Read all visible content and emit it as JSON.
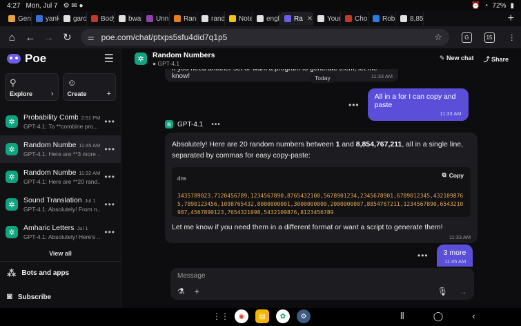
{
  "status_bar": {
    "time": "4:27",
    "date": "Mon, Jul 7",
    "battery": "72%"
  },
  "tabs": [
    {
      "label": "Gene",
      "color": "#e8a33c"
    },
    {
      "label": "yank",
      "color": "#3b6fd8"
    },
    {
      "label": "garo",
      "color": "#e0e0e0"
    },
    {
      "label": "Body",
      "color": "#c0392b"
    },
    {
      "label": "bwa",
      "color": "#e0e0e0"
    },
    {
      "label": "Unn",
      "color": "#8e44ad"
    },
    {
      "label": "Rand",
      "color": "#e67e22"
    },
    {
      "label": "rand",
      "color": "#e0e0e0"
    },
    {
      "label": "Note",
      "color": "#f1c40f"
    },
    {
      "label": "engl",
      "color": "#e0e0e0"
    },
    {
      "label": "Ra",
      "color": "#6c5ce7",
      "active": true
    },
    {
      "label": "Your",
      "color": "#e0e0e0"
    },
    {
      "label": "Chop",
      "color": "#c0392b"
    },
    {
      "label": "Robl",
      "color": "#2d7be5"
    },
    {
      "label": "8,85",
      "color": "#e0e0e0"
    }
  ],
  "address_bar": {
    "url": "poe.com/chat/ptxps5sfu4did7q1p5"
  },
  "sidebar": {
    "logo": "Poe",
    "explore_label": "Explore",
    "create_label": "Create",
    "conversations": [
      {
        "title": "Probability Comb...",
        "time": "2:51 PM",
        "preview": "GPT-4.1: To **combine pro..."
      },
      {
        "title": "Random Numbe...",
        "time": "11:45 AM",
        "preview": "GPT-4.1: Here are **3 more ...",
        "active": true
      },
      {
        "title": "Random Numbe...",
        "time": "11:32 AM",
        "preview": "GPT-4.1: Here are **20 rand..."
      },
      {
        "title": "Sound Translation",
        "time": "Jul 1",
        "preview": "GPT-4.1: Absolutely! From n..."
      },
      {
        "title": "Amharic Letters",
        "time": "Jul 1",
        "preview": "GPT-4.1: Absolutely! Here's ..."
      }
    ],
    "view_all": "View all",
    "bots_and_apps": "Bots and apps",
    "subscribe": "Subscribe"
  },
  "chat": {
    "title": "Random Numbers",
    "bot_name": "GPT-4.1",
    "new_chat": "New chat",
    "share": "Share",
    "prev_message": "If you need another set or want a program to generate them, let me know!",
    "prev_time": "11:33 AM",
    "day_label": "Today",
    "user_message_1": "All in a for I can copy and paste",
    "user_time_1": "11:33 AM",
    "bot_intro_a": "Absolutely! Here are 20 random numbers between ",
    "bot_intro_b1": "1",
    "bot_intro_and": " and ",
    "bot_intro_b2": "8,854,767,211",
    "bot_intro_c": ", all in a single line, separated by commas for easy copy-paste:",
    "code_lang": "dns",
    "copy_label": "Copy",
    "code": "3435789023,7120456789,1234567890,8765432100,5678901234,2345678901,6789012345,4321098765,7890123456,1098765432,8000000001,3000000000,2000000007,8854767211,1234567890,6543210987,4567890123,7654321098,5432109876,8123456789",
    "bot_outro": "Let me know if you need them in a different format or want a script to generate them!",
    "bot_time": "11:33 AM",
    "user_message_2": "3 more",
    "user_time_2": "11:45 AM",
    "composer_placeholder": "Message"
  }
}
